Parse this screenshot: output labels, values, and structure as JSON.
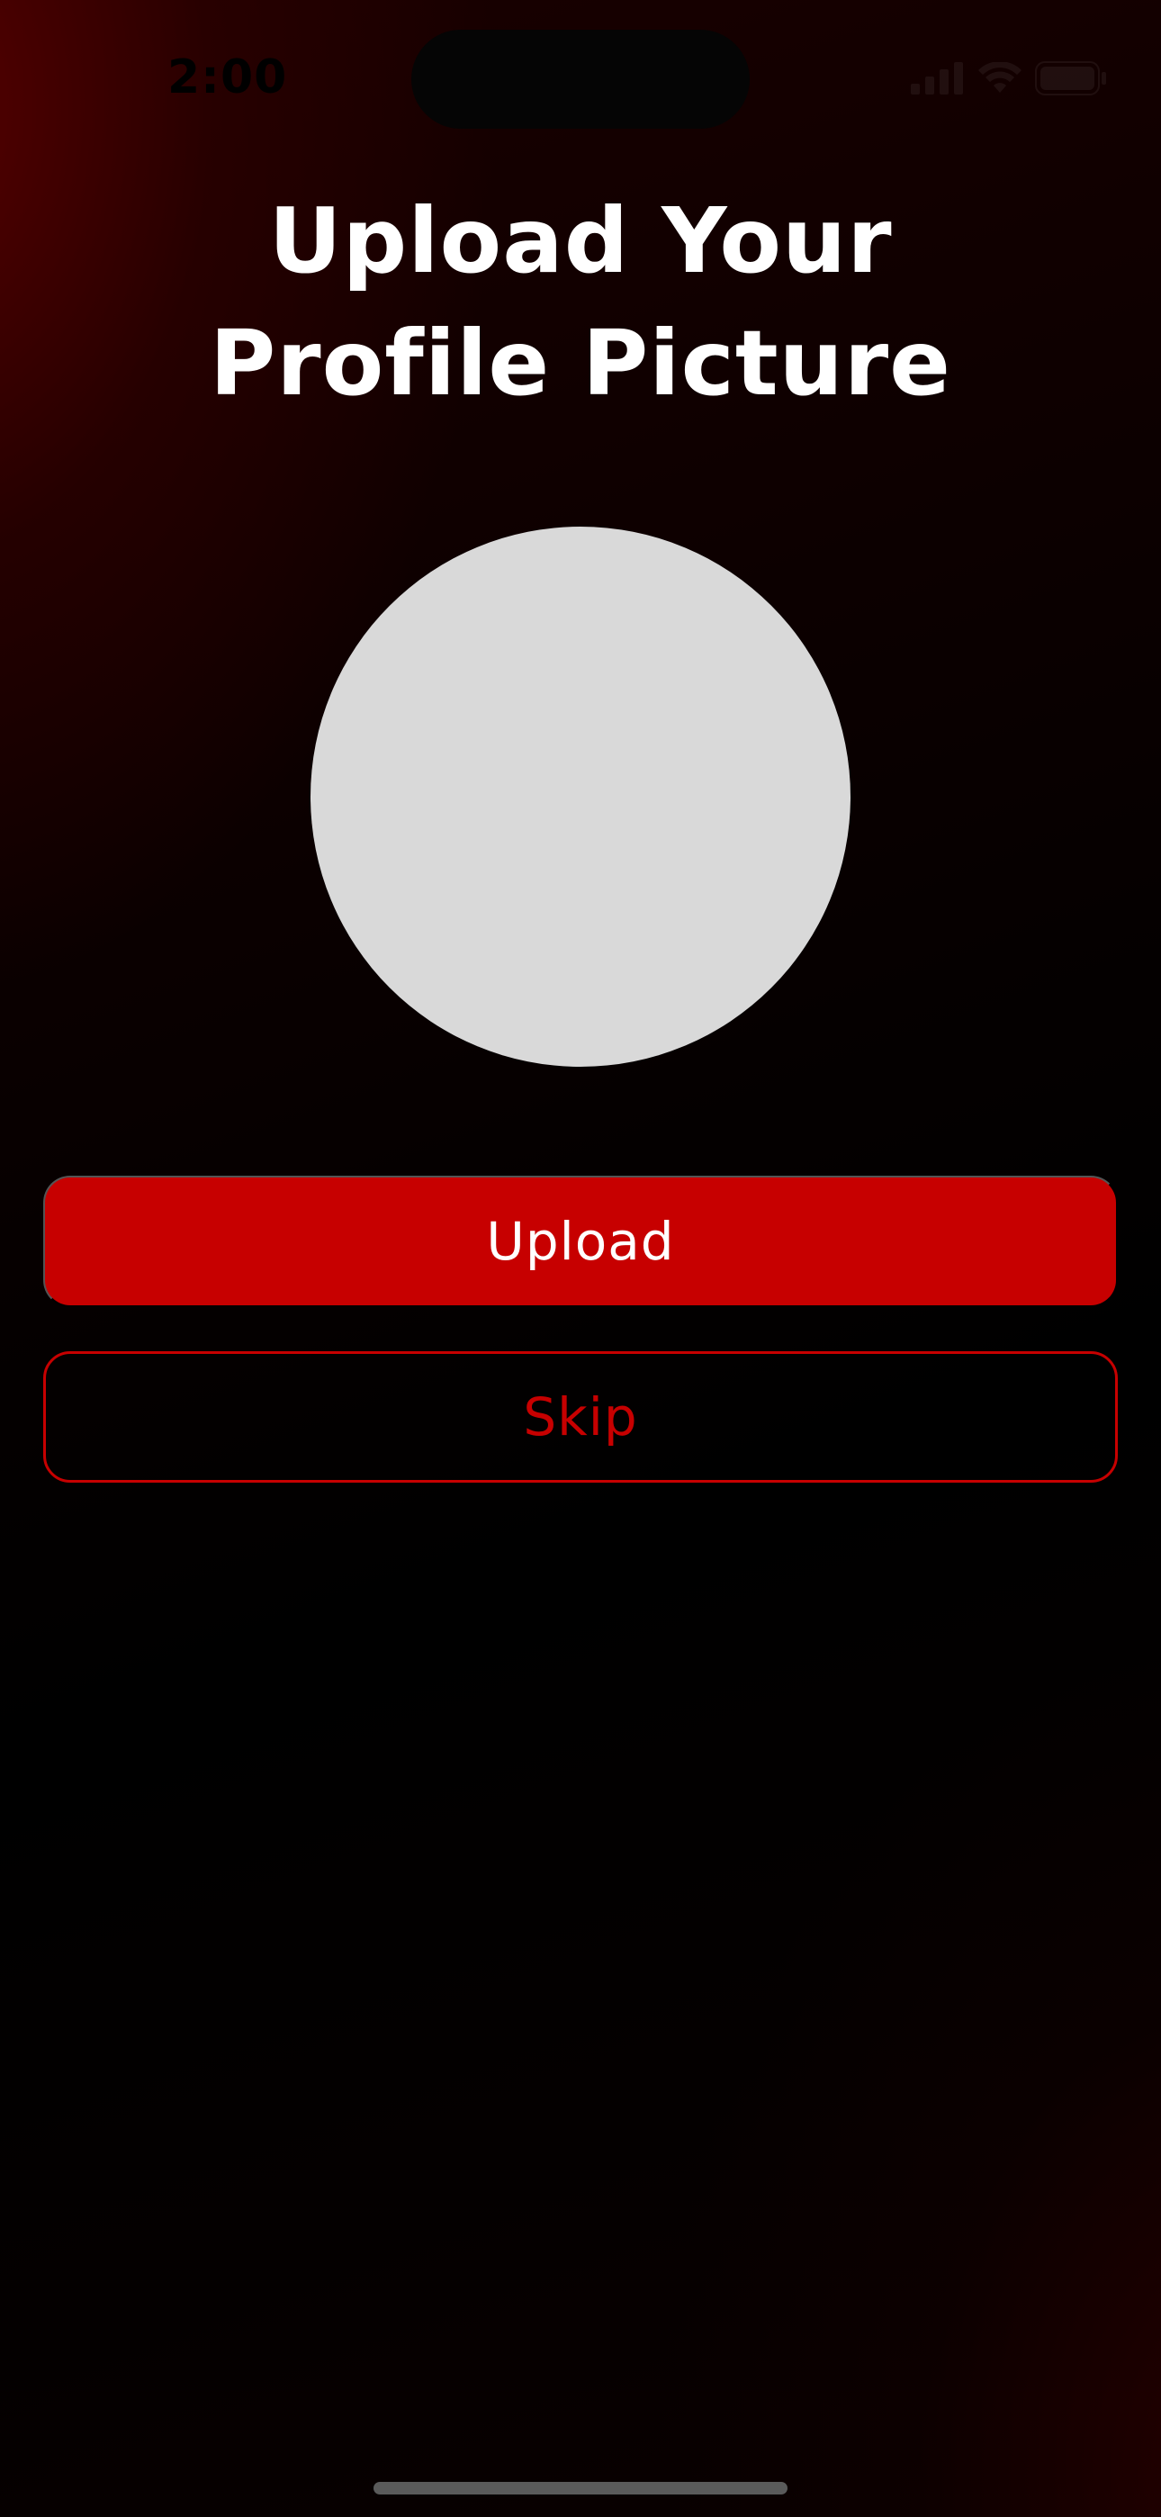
{
  "status_bar": {
    "time": "2:00"
  },
  "title": {
    "line1": "Upload Your",
    "line2": "Profile Picture"
  },
  "avatar": {
    "color": "#d9d9d9"
  },
  "buttons": {
    "upload_label": "Upload",
    "skip_label": "Skip"
  },
  "colors": {
    "accent": "#c70000",
    "background": "#000000",
    "text": "#ffffff"
  },
  "icons": [
    "signal-icon",
    "wifi-icon",
    "battery-icon"
  ]
}
